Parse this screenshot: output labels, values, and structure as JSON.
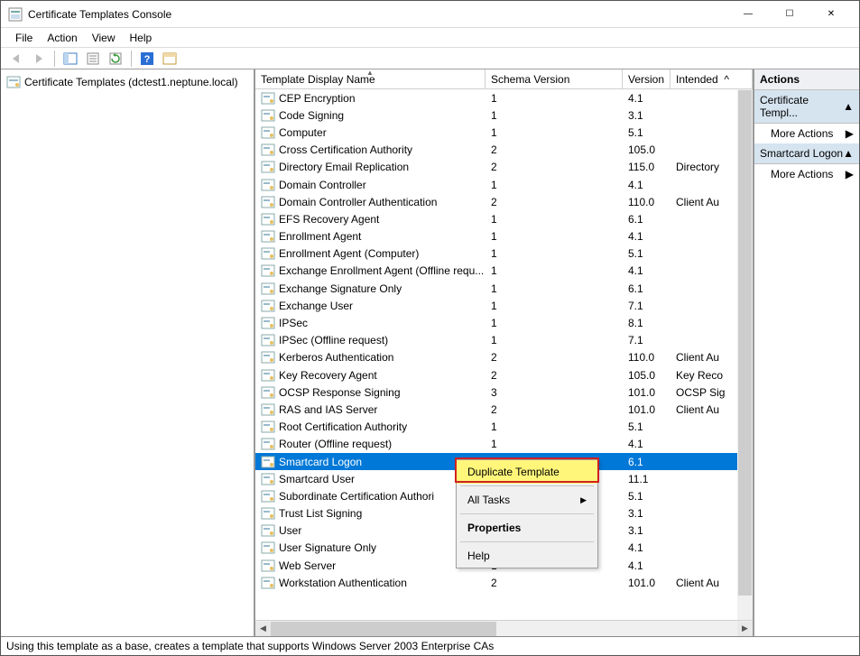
{
  "window": {
    "title": "Certificate Templates Console"
  },
  "menu": [
    "File",
    "Action",
    "View",
    "Help"
  ],
  "tree": {
    "root_label": "Certificate Templates (dctest1.neptune.local)"
  },
  "list": {
    "headers": {
      "name": "Template Display Name",
      "schema": "Schema Version",
      "version": "Version",
      "intended": "Intended"
    },
    "rows": [
      {
        "name": "CEP Encryption",
        "sv": "1",
        "ver": "4.1",
        "int": ""
      },
      {
        "name": "Code Signing",
        "sv": "1",
        "ver": "3.1",
        "int": ""
      },
      {
        "name": "Computer",
        "sv": "1",
        "ver": "5.1",
        "int": ""
      },
      {
        "name": "Cross Certification Authority",
        "sv": "2",
        "ver": "105.0",
        "int": ""
      },
      {
        "name": "Directory Email Replication",
        "sv": "2",
        "ver": "115.0",
        "int": "Directory"
      },
      {
        "name": "Domain Controller",
        "sv": "1",
        "ver": "4.1",
        "int": ""
      },
      {
        "name": "Domain Controller Authentication",
        "sv": "2",
        "ver": "110.0",
        "int": "Client Au"
      },
      {
        "name": "EFS Recovery Agent",
        "sv": "1",
        "ver": "6.1",
        "int": ""
      },
      {
        "name": "Enrollment Agent",
        "sv": "1",
        "ver": "4.1",
        "int": ""
      },
      {
        "name": "Enrollment Agent (Computer)",
        "sv": "1",
        "ver": "5.1",
        "int": ""
      },
      {
        "name": "Exchange Enrollment Agent (Offline requ...",
        "sv": "1",
        "ver": "4.1",
        "int": ""
      },
      {
        "name": "Exchange Signature Only",
        "sv": "1",
        "ver": "6.1",
        "int": ""
      },
      {
        "name": "Exchange User",
        "sv": "1",
        "ver": "7.1",
        "int": ""
      },
      {
        "name": "IPSec",
        "sv": "1",
        "ver": "8.1",
        "int": ""
      },
      {
        "name": "IPSec (Offline request)",
        "sv": "1",
        "ver": "7.1",
        "int": ""
      },
      {
        "name": "Kerberos Authentication",
        "sv": "2",
        "ver": "110.0",
        "int": "Client Au"
      },
      {
        "name": "Key Recovery Agent",
        "sv": "2",
        "ver": "105.0",
        "int": "Key Reco"
      },
      {
        "name": "OCSP Response Signing",
        "sv": "3",
        "ver": "101.0",
        "int": "OCSP Sig"
      },
      {
        "name": "RAS and IAS Server",
        "sv": "2",
        "ver": "101.0",
        "int": "Client Au"
      },
      {
        "name": "Root Certification Authority",
        "sv": "1",
        "ver": "5.1",
        "int": ""
      },
      {
        "name": "Router (Offline request)",
        "sv": "1",
        "ver": "4.1",
        "int": ""
      },
      {
        "name": "Smartcard Logon",
        "sv": "",
        "ver": "6.1",
        "int": "",
        "selected": true
      },
      {
        "name": "Smartcard User",
        "sv": "",
        "ver": "11.1",
        "int": ""
      },
      {
        "name": "Subordinate Certification Authori",
        "sv": "",
        "ver": "5.1",
        "int": ""
      },
      {
        "name": "Trust List Signing",
        "sv": "",
        "ver": "3.1",
        "int": ""
      },
      {
        "name": "User",
        "sv": "",
        "ver": "3.1",
        "int": ""
      },
      {
        "name": "User Signature Only",
        "sv": "",
        "ver": "4.1",
        "int": ""
      },
      {
        "name": "Web Server",
        "sv": "1",
        "ver": "4.1",
        "int": ""
      },
      {
        "name": "Workstation Authentication",
        "sv": "2",
        "ver": "101.0",
        "int": "Client Au"
      }
    ]
  },
  "context_menu": {
    "duplicate": "Duplicate Template",
    "all_tasks": "All Tasks",
    "properties": "Properties",
    "help": "Help"
  },
  "actions": {
    "header": "Actions",
    "section1": "Certificate Templ...",
    "section2": "Smartcard Logon",
    "more": "More Actions"
  },
  "status": "Using this template as a base, creates a template that supports Windows Server 2003 Enterprise CAs"
}
